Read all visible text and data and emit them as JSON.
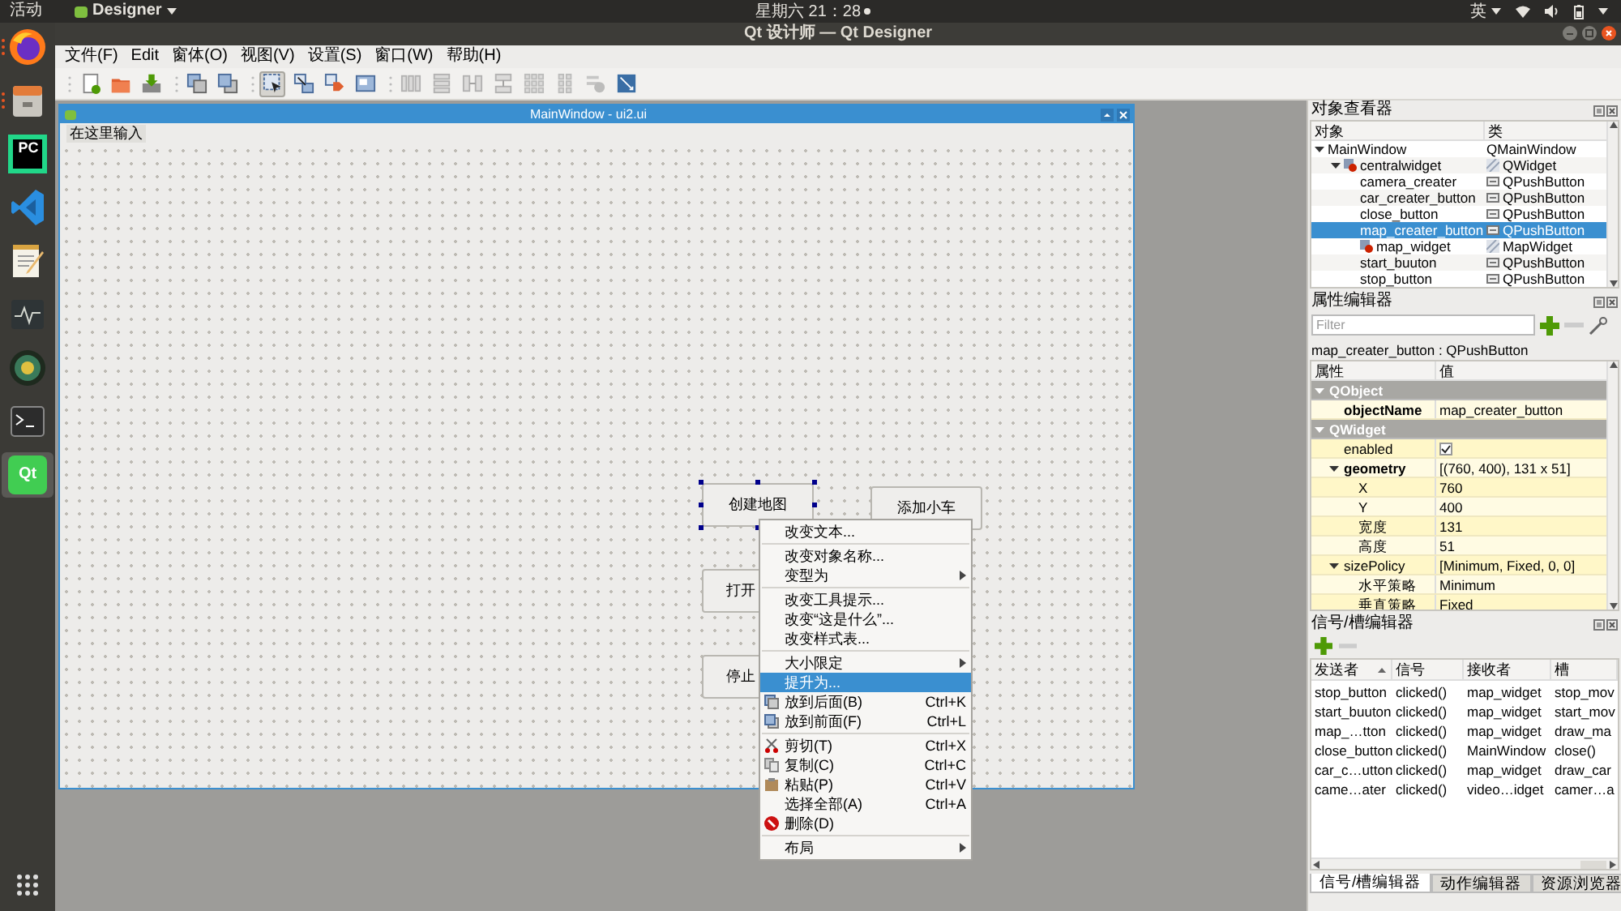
{
  "top_bar": {
    "activities": "活动",
    "app_menu": "Designer",
    "clock": "星期六 21：28",
    "input_method": "英"
  },
  "dock": [
    {
      "kind": "browser",
      "running": true,
      "selected": false
    },
    {
      "kind": "files",
      "running": true,
      "selected": false
    },
    {
      "kind": "ide",
      "logo_text": "PC",
      "running": false,
      "selected": false
    },
    {
      "kind": "code",
      "running": false,
      "selected": false
    },
    {
      "kind": "notes",
      "running": false,
      "selected": false
    },
    {
      "kind": "monitor",
      "running": false,
      "selected": false
    },
    {
      "kind": "globe",
      "running": false,
      "selected": false
    },
    {
      "kind": "terminal",
      "running": false,
      "selected": false
    },
    {
      "kind": "designer",
      "logo_text": "Qt",
      "running": false,
      "selected": true
    }
  ],
  "window": {
    "title": "Qt 设计师 — Qt Designer"
  },
  "menu_bar": [
    "文件(F)",
    "Edit",
    "窗体(O)",
    "视图(V)",
    "设置(S)",
    "窗口(W)",
    "帮助(H)"
  ],
  "toolbar": [
    {
      "selected": false,
      "disabled": false
    },
    {
      "selected": false,
      "disabled": false
    },
    {
      "selected": false,
      "disabled": false
    },
    {
      "selected": false,
      "disabled": false
    },
    {
      "selected": false,
      "disabled": false
    },
    {
      "selected": true,
      "disabled": false
    },
    {
      "selected": false,
      "disabled": false
    },
    {
      "selected": false,
      "disabled": false
    },
    {
      "selected": false,
      "disabled": false
    },
    {
      "selected": false,
      "disabled": true
    },
    {
      "selected": false,
      "disabled": true
    },
    {
      "selected": false,
      "disabled": true
    },
    {
      "selected": false,
      "disabled": true
    },
    {
      "selected": false,
      "disabled": true
    },
    {
      "selected": false,
      "disabled": true
    },
    {
      "selected": false,
      "disabled": true
    },
    {
      "selected": false,
      "disabled": false
    }
  ],
  "form_window": {
    "title": "MainWindow - ui2.ui",
    "menu_placeholder": "在这里输入",
    "buttons": [
      {
        "label": "创建地图",
        "selected": true
      },
      {
        "label": "添加小车",
        "selected": false
      },
      {
        "label": "打开",
        "selected": false
      },
      {
        "label": "停止",
        "selected": false
      }
    ]
  },
  "context_menu": [
    {
      "kind": "action",
      "label": "改变文本...",
      "selected": false
    },
    {
      "kind": "separator"
    },
    {
      "kind": "action",
      "label": "改变对象名称...",
      "selected": false
    },
    {
      "kind": "submenu",
      "label": "变型为",
      "selected": false
    },
    {
      "kind": "separator"
    },
    {
      "kind": "action",
      "label": "改变工具提示...",
      "selected": false
    },
    {
      "kind": "action",
      "label": "改变“这是什么”...",
      "selected": false
    },
    {
      "kind": "action",
      "label": "改变样式表...",
      "selected": false
    },
    {
      "kind": "separator"
    },
    {
      "kind": "submenu",
      "label": "大小限定",
      "selected": false
    },
    {
      "kind": "action",
      "label": "提升为...",
      "selected": true
    },
    {
      "kind": "action",
      "label": "放到后面(B)",
      "shortcut": "Ctrl+K",
      "selected": false
    },
    {
      "kind": "action",
      "label": "放到前面(F)",
      "shortcut": "Ctrl+L",
      "selected": false
    },
    {
      "kind": "separator"
    },
    {
      "kind": "action",
      "label": "剪切(T)",
      "shortcut": "Ctrl+X",
      "selected": false
    },
    {
      "kind": "action",
      "label": "复制(C)",
      "shortcut": "Ctrl+C",
      "selected": false
    },
    {
      "kind": "action",
      "label": "粘贴(P)",
      "shortcut": "Ctrl+V",
      "selected": false
    },
    {
      "kind": "action",
      "label": "选择全部(A)",
      "shortcut": "Ctrl+A",
      "selected": false
    },
    {
      "kind": "action",
      "label": "删除(D)",
      "selected": false
    },
    {
      "kind": "separator"
    },
    {
      "kind": "submenu",
      "label": "布局",
      "selected": false
    }
  ],
  "object_inspector": {
    "title": "对象查看器",
    "columns": [
      "对象",
      "类"
    ],
    "items": [
      {
        "kind": "window",
        "name": "MainWindow",
        "class": "QMainWindow",
        "expanded": true,
        "selected": false,
        "children": [
          {
            "kind": "container",
            "name": "centralwidget",
            "class": "QWidget",
            "expanded": true,
            "selected": false,
            "children": [
              {
                "kind": "button",
                "name": "camera_creater",
                "class": "QPushButton",
                "selected": false
              },
              {
                "kind": "button",
                "name": "car_creater_button",
                "class": "QPushButton",
                "selected": false
              },
              {
                "kind": "button",
                "name": "close_button",
                "class": "QPushButton",
                "selected": false
              },
              {
                "kind": "button",
                "name": "map_creater_button",
                "class": "QPushButton",
                "selected": true
              },
              {
                "kind": "container",
                "name": "map_widget",
                "class": "MapWidget",
                "selected": false
              },
              {
                "kind": "button",
                "name": "start_buuton",
                "class": "QPushButton",
                "selected": false
              },
              {
                "kind": "button",
                "name": "stop_button",
                "class": "QPushButton",
                "selected": false
              }
            ]
          }
        ]
      }
    ]
  },
  "property_editor": {
    "title": "属性编辑器",
    "filter_placeholder": "Filter",
    "object_label": "map_creater_button : QPushButton",
    "columns": [
      "属性",
      "值"
    ],
    "rows": [
      {
        "kind": "group",
        "name": "QObject",
        "expanded": true,
        "children": [
          {
            "kind": "property",
            "name": "objectName",
            "value": "map_creater_button",
            "modified": true
          }
        ]
      },
      {
        "kind": "group",
        "name": "QWidget",
        "expanded": true,
        "children": [
          {
            "kind": "checkbox",
            "name": "enabled",
            "checked": true,
            "modified": false
          },
          {
            "kind": "property",
            "name": "geometry",
            "value": "[(760, 400), 131 x 51]",
            "modified": true,
            "expanded": true,
            "children": [
              {
                "kind": "property",
                "name": "X",
                "value": "760",
                "modified": false
              },
              {
                "kind": "property",
                "name": "Y",
                "value": "400",
                "modified": false
              },
              {
                "kind": "property",
                "name": "宽度",
                "value": "131",
                "modified": false
              },
              {
                "kind": "property",
                "name": "高度",
                "value": "51",
                "modified": false
              }
            ]
          },
          {
            "kind": "property",
            "name": "sizePolicy",
            "value": "[Minimum, Fixed, 0, 0]",
            "modified": false,
            "expanded": true,
            "children": [
              {
                "kind": "property",
                "name": "水平策略",
                "value": "Minimum",
                "modified": false
              },
              {
                "kind": "property",
                "name": "垂直策略",
                "value": "Fixed",
                "modified": false
              }
            ]
          }
        ]
      }
    ]
  },
  "signal_slot_editor": {
    "title": "信号/槽编辑器",
    "columns": [
      {
        "label": "发送者",
        "sorted": true
      },
      {
        "label": "信号",
        "sorted": false
      },
      {
        "label": "接收者",
        "sorted": false
      },
      {
        "label": "槽",
        "sorted": false
      }
    ],
    "rows": [
      [
        "stop_button",
        "clicked()",
        "map_widget",
        "stop_mov"
      ],
      [
        "start_buuton",
        "clicked()",
        "map_widget",
        "start_mov"
      ],
      [
        "map_…tton",
        "clicked()",
        "map_widget",
        "draw_ma"
      ],
      [
        "close_button",
        "clicked()",
        "MainWindow",
        "close()"
      ],
      [
        "car_c…utton",
        "clicked()",
        "map_widget",
        "draw_car"
      ],
      [
        "came…ater",
        "clicked()",
        "video…idget",
        "camer…a"
      ]
    ]
  },
  "bottom_tabs": [
    {
      "label": "信号/槽编辑器",
      "selected": true
    },
    {
      "label": "动作编辑器",
      "selected": false
    },
    {
      "label": "资源浏览器",
      "selected": false
    }
  ]
}
